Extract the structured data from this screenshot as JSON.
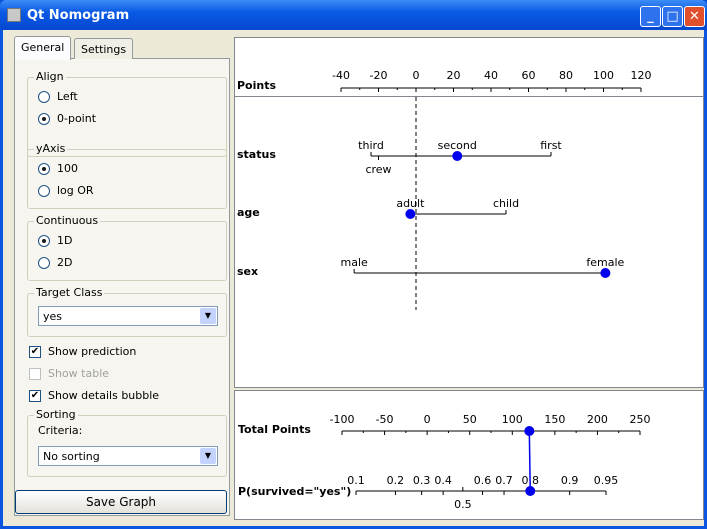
{
  "window": {
    "title": "Qt Nomogram"
  },
  "tabs": [
    "General",
    "Settings"
  ],
  "align": {
    "label": "Align",
    "options": [
      "Left",
      "0-point"
    ],
    "selected": 1
  },
  "yaxis": {
    "label": "yAxis",
    "options": [
      "100",
      "log OR"
    ],
    "selected": 0
  },
  "continuous": {
    "label": "Continuous",
    "options": [
      "1D",
      "2D"
    ],
    "selected": 0
  },
  "target_class": {
    "label": "Target Class",
    "value": "yes"
  },
  "checks": [
    {
      "label": "Show prediction",
      "checked": true,
      "enabled": true
    },
    {
      "label": "Show table",
      "checked": false,
      "enabled": false
    },
    {
      "label": "Show details bubble",
      "checked": true,
      "enabled": true
    }
  ],
  "sorting": {
    "label": "Sorting",
    "criteria_label": "Criteria:",
    "value": "No sorting"
  },
  "save_button": "Save Graph",
  "chart_data": {
    "type": "nomogram",
    "points_axis": {
      "label": "Points",
      "range": [
        -40,
        120
      ],
      "ticks": [
        -40,
        -20,
        0,
        20,
        40,
        60,
        80,
        100,
        120
      ]
    },
    "attributes": [
      {
        "name": "status",
        "values": [
          {
            "label": "third",
            "points": -24
          },
          {
            "label": "crew",
            "points": -20,
            "below": true
          },
          {
            "label": "second",
            "points": 22
          },
          {
            "label": "first",
            "points": 72
          }
        ],
        "selected": "second"
      },
      {
        "name": "age",
        "values": [
          {
            "label": "adult",
            "points": -3
          },
          {
            "label": "child",
            "points": 48
          }
        ],
        "selected": "adult"
      },
      {
        "name": "sex",
        "values": [
          {
            "label": "male",
            "points": -33
          },
          {
            "label": "female",
            "points": 101
          }
        ],
        "selected": "female"
      }
    ],
    "total_axis": {
      "label": "Total Points",
      "range": [
        -100,
        250
      ],
      "ticks": [
        -100,
        -50,
        0,
        50,
        100,
        150,
        200,
        250
      ],
      "value": 120
    },
    "prob_axis": {
      "label": "P(survived=\"yes\")",
      "ticks": [
        0.1,
        0.2,
        0.3,
        0.4,
        0.5,
        0.6,
        0.7,
        0.8,
        0.9,
        0.95
      ],
      "below": [
        0.5
      ],
      "value": 0.8
    },
    "colors": {
      "marker": "#0000ee"
    }
  }
}
